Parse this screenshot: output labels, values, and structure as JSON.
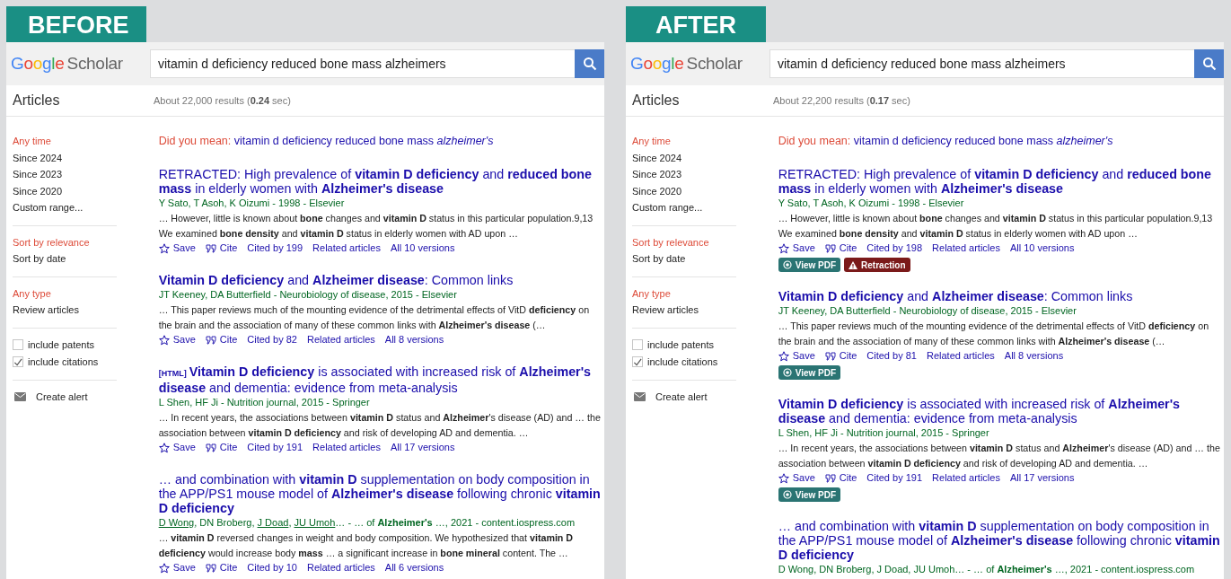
{
  "panels": [
    {
      "label": "BEFORE",
      "logo": {
        "brand": "Google",
        "product": "Scholar"
      },
      "query": "vitamin d deficiency reduced bone mass alzheimers",
      "section": "Articles",
      "stats": "About 22,000 results (**0.24** sec)",
      "sidebar": [
        {
          "kind": "options",
          "items": [
            {
              "label": "Any time",
              "selected": true
            },
            {
              "label": "Since 2024",
              "selected": false
            },
            {
              "label": "Since 2023",
              "selected": false
            },
            {
              "label": "Since 2020",
              "selected": false
            },
            {
              "label": "Custom range...",
              "selected": false
            }
          ]
        },
        {
          "kind": "options",
          "items": [
            {
              "label": "Sort by relevance",
              "selected": true
            },
            {
              "label": "Sort by date",
              "selected": false
            }
          ]
        },
        {
          "kind": "options",
          "items": [
            {
              "label": "Any type",
              "selected": true
            },
            {
              "label": "Review articles",
              "selected": false
            }
          ]
        },
        {
          "kind": "checks",
          "items": [
            {
              "label": "include patents",
              "checked": false
            },
            {
              "label": "include citations",
              "checked": true
            }
          ]
        },
        {
          "kind": "alert",
          "items": [
            {
              "label": "Create alert"
            }
          ]
        }
      ],
      "did_you_mean": {
        "prompt": "Did you mean:",
        "suggestion": "vitamin d deficiency reduced bone mass *alzheimer's*"
      },
      "results": [
        {
          "title": "RETRACTED: High prevalence of **vitamin D deficiency** and **reduced bone mass** in elderly women with **Alzheimer's disease**",
          "source": [
            {
              "text": "Y Sato, T Asoh, K Oizumi - 1998 - Elsevier",
              "linked": false
            }
          ],
          "snippet": "… However, little is known about **bone** changes and **vitamin D** status in this particular population.9,13 We examined **bone density** and **vitamin D** status in elderly women with AD upon …",
          "actions": {
            "save": "Save",
            "cite": "Cite",
            "cited_by": "Cited by 199",
            "related": "Related articles",
            "versions": "All 10 versions"
          }
        },
        {
          "title": "**Vitamin D deficiency** and **Alzheimer disease**: Common links",
          "source": [
            {
              "text": "JT Keeney, DA Butterfield - Neurobiology of disease, 2015 - Elsevier",
              "linked": false
            }
          ],
          "snippet": "… This paper reviews much of the mounting evidence of the detrimental effects of VitD **deficiency** on the brain and the association of many of these common links with **Alzheimer's disease** (…",
          "actions": {
            "save": "Save",
            "cite": "Cite",
            "cited_by": "Cited by 82",
            "related": "Related articles",
            "versions": "All 8 versions"
          }
        },
        {
          "format": "[HTML]",
          "title": "**Vitamin D deficiency** is associated with increased risk of **Alzheimer's disease** and dementia: evidence from meta-analysis",
          "source": [
            {
              "text": "L Shen, HF Ji - Nutrition journal, 2015 - Springer",
              "linked": false
            }
          ],
          "snippet": "… In recent years, the associations between **vitamin D** status and **Alzheimer**'s disease (AD) and … the association between **vitamin D deficiency** and risk of developing AD and dementia. …",
          "actions": {
            "save": "Save",
            "cite": "Cite",
            "cited_by": "Cited by 191",
            "related": "Related articles",
            "versions": "All 17 versions"
          }
        },
        {
          "title": "… and combination with **vitamin D** supplementation on body composition in the APP/PS1 mouse model of **Alzheimer's disease** following chronic **vitamin D deficiency**",
          "source": [
            {
              "text": "D Wong",
              "linked": true
            },
            {
              "text": ", DN Broberg, ",
              "linked": false
            },
            {
              "text": "J Doad",
              "linked": true
            },
            {
              "text": ", ",
              "linked": false
            },
            {
              "text": "JU Umoh",
              "linked": true
            },
            {
              "text": "… - … of **Alzheimer's** …, 2021 - content.iospress.com",
              "linked": false
            }
          ],
          "snippet": "… **vitamin D** reversed changes in weight and body composition. We hypothesized that **vitamin D deficiency** would increase body **mass** … a significant increase in **bone mineral** content. The …",
          "actions": {
            "save": "Save",
            "cite": "Cite",
            "cited_by": "Cited by 10",
            "related": "Related articles",
            "versions": "All 6 versions"
          }
        }
      ]
    },
    {
      "label": "AFTER",
      "logo": {
        "brand": "Google",
        "product": "Scholar"
      },
      "query": "vitamin d deficiency reduced bone mass alzheimers",
      "section": "Articles",
      "stats": "About 22,200 results (**0.17** sec)",
      "sidebar": [
        {
          "kind": "options",
          "items": [
            {
              "label": "Any time",
              "selected": true
            },
            {
              "label": "Since 2024",
              "selected": false
            },
            {
              "label": "Since 2023",
              "selected": false
            },
            {
              "label": "Since 2020",
              "selected": false
            },
            {
              "label": "Custom range...",
              "selected": false
            }
          ]
        },
        {
          "kind": "options",
          "items": [
            {
              "label": "Sort by relevance",
              "selected": true
            },
            {
              "label": "Sort by date",
              "selected": false
            }
          ]
        },
        {
          "kind": "options",
          "items": [
            {
              "label": "Any type",
              "selected": true
            },
            {
              "label": "Review articles",
              "selected": false
            }
          ]
        },
        {
          "kind": "checks",
          "items": [
            {
              "label": "include patents",
              "checked": false
            },
            {
              "label": "include citations",
              "checked": true
            }
          ]
        },
        {
          "kind": "alert",
          "items": [
            {
              "label": "Create alert"
            }
          ]
        }
      ],
      "did_you_mean": {
        "prompt": "Did you mean:",
        "suggestion": "vitamin d deficiency reduced bone mass *alzheimer's*"
      },
      "results": [
        {
          "title": "RETRACTED: High prevalence of **vitamin D deficiency** and **reduced bone mass** in elderly women with **Alzheimer's disease**",
          "source": [
            {
              "text": "Y Sato, T Asoh, K Oizumi - 1998 - Elsevier",
              "linked": false
            }
          ],
          "snippet": "… However, little is known about **bone** changes and **vitamin D** status in this particular population.9,13 We examined **bone density** and **vitamin D** status in elderly women with AD upon …",
          "actions": {
            "save": "Save",
            "cite": "Cite",
            "cited_by": "Cited by 198",
            "related": "Related articles",
            "versions": "All 10 versions"
          },
          "badges": [
            {
              "kind": "pdf",
              "label": "View PDF"
            },
            {
              "kind": "retraction",
              "label": "Retraction"
            }
          ]
        },
        {
          "title": "**Vitamin D deficiency** and **Alzheimer disease**: Common links",
          "source": [
            {
              "text": "JT Keeney, DA Butterfield - Neurobiology of disease, 2015 - Elsevier",
              "linked": false
            }
          ],
          "snippet": "… This paper reviews much of the mounting evidence of the detrimental effects of VitD **deficiency** on the brain and the association of many of these common links with **Alzheimer's disease** (…",
          "actions": {
            "save": "Save",
            "cite": "Cite",
            "cited_by": "Cited by 81",
            "related": "Related articles",
            "versions": "All 8 versions"
          },
          "badges": [
            {
              "kind": "pdf",
              "label": "View PDF"
            }
          ]
        },
        {
          "title": "**Vitamin D deficiency** is associated with increased risk of **Alzheimer's disease** and dementia: evidence from meta-analysis",
          "source": [
            {
              "text": "L Shen, HF Ji - Nutrition journal, 2015 - Springer",
              "linked": false
            }
          ],
          "snippet": "… In recent years, the associations between **vitamin D** status and **Alzheimer**'s disease (AD) and … the association between **vitamin D deficiency** and risk of developing AD and dementia. …",
          "actions": {
            "save": "Save",
            "cite": "Cite",
            "cited_by": "Cited by 191",
            "related": "Related articles",
            "versions": "All 17 versions"
          },
          "badges": [
            {
              "kind": "pdf",
              "label": "View PDF"
            }
          ]
        },
        {
          "title": "… and combination with **vitamin D** supplementation on body composition in the APP/PS1 mouse model of **Alzheimer's disease** following chronic **vitamin D deficiency**",
          "source": [
            {
              "text": "D Wong, DN Broberg, J Doad, JU Umoh… - … of **Alzheimer's** …, 2021 - content.iospress.com",
              "linked": false
            }
          ]
        }
      ]
    }
  ]
}
